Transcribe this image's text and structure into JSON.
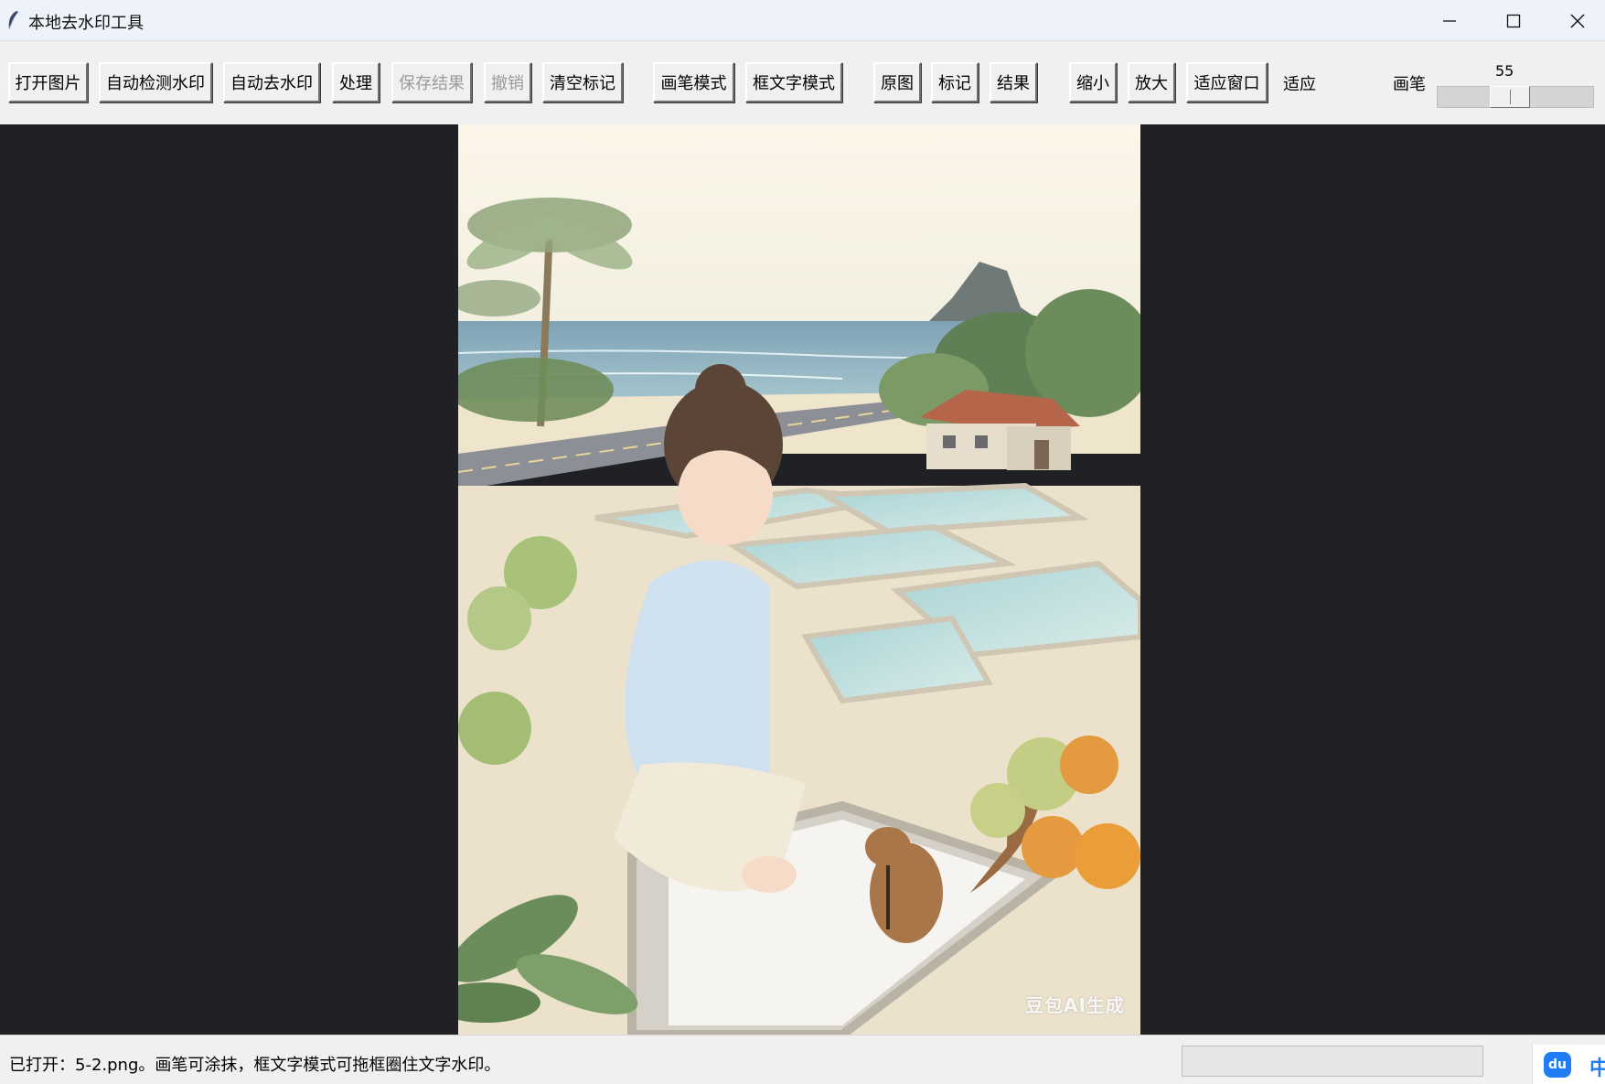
{
  "window": {
    "title": "本地去水印工具",
    "icons": {
      "app": "feather-icon",
      "minimize": "minimize-icon",
      "maximize": "maximize-icon",
      "close": "close-icon"
    }
  },
  "toolbar": {
    "open_image": "打开图片",
    "auto_detect": "自动检测水印",
    "auto_remove": "自动去水印",
    "process": "处理",
    "save_result": "保存结果",
    "undo": "撤销",
    "clear_marks": "清空标记",
    "brush_mode": "画笔模式",
    "box_text_mode": "框文字模式",
    "view_original": "原图",
    "view_marks": "标记",
    "view_result": "结果",
    "zoom_out": "缩小",
    "zoom_in": "放大",
    "fit_window": "适应窗口",
    "zoom_label": "适应",
    "brush_label": "画笔",
    "brush_size": "55",
    "brush_fraction": 0.45
  },
  "canvas": {
    "watermark_text": "豆包AI生成",
    "colors": {
      "background": "#1f2125"
    }
  },
  "status": {
    "message": "已打开：5-2.png。画笔可涂抹，框文字模式可拖框圈住文字水印。",
    "progress": 0
  },
  "taskbar": {
    "ime_icon_text": "du",
    "ime_lang": "中"
  }
}
